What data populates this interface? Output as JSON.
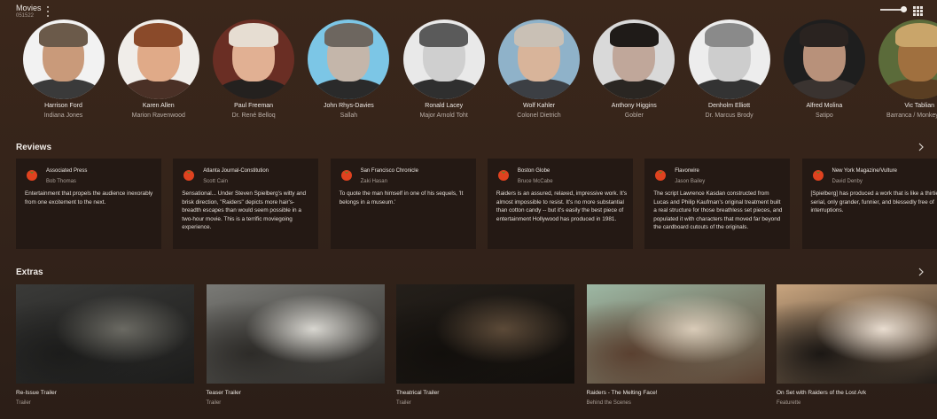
{
  "app": {
    "title": "Movies",
    "subtitle": "051522"
  },
  "view": {
    "zoom_level": 0.85
  },
  "cast": [
    {
      "name": "Harrison Ford",
      "character": "Indiana Jones",
      "bg": "#f2f2f2",
      "face": "#c99a7a",
      "hair": "#6b5a4a",
      "shirt": "#3a3a3a"
    },
    {
      "name": "Karen Allen",
      "character": "Marion Ravenwood",
      "bg": "#f0ede9",
      "face": "#e0aa88",
      "hair": "#8a4a2a",
      "shirt": "#4a3026"
    },
    {
      "name": "Paul Freeman",
      "character": "Dr. René Belloq",
      "bg": "#6a2e24",
      "face": "#e1b093",
      "hair": "#e6ddd2",
      "shirt": "#24211f"
    },
    {
      "name": "John Rhys-Davies",
      "character": "Sallah",
      "bg": "#7cc6e6",
      "face": "#c4b6aa",
      "hair": "#6d665f",
      "shirt": "#2a2a2a"
    },
    {
      "name": "Ronald Lacey",
      "character": "Major Arnold Toht",
      "bg": "#e9e9e9",
      "face": "#cfcfcf",
      "hair": "#5a5a5a",
      "shirt": "#2f2f2f"
    },
    {
      "name": "Wolf Kahler",
      "character": "Colonel Dietrich",
      "bg": "#8fb2c9",
      "face": "#d8b49a",
      "hair": "#c9c0b5",
      "shirt": "#3c3f44"
    },
    {
      "name": "Anthony Higgins",
      "character": "Gobler",
      "bg": "#d9d9d9",
      "face": "#c0a79a",
      "hair": "#1f1b18",
      "shirt": "#2a2622"
    },
    {
      "name": "Denholm Elliott",
      "character": "Dr. Marcus Brody",
      "bg": "#ededed",
      "face": "#cdcdcd",
      "hair": "#8a8a8a",
      "shirt": "#333333"
    },
    {
      "name": "Alfred Molina",
      "character": "Satipo",
      "bg": "#1e1e1e",
      "face": "#b8917a",
      "hair": "#2a2320",
      "shirt": "#3a3330"
    },
    {
      "name": "Vic Tablian",
      "character": "Barranca / Monkey Man",
      "bg": "#5b6b3a",
      "face": "#a0703f",
      "hair": "#c9a56a",
      "shirt": "#5a3e22"
    }
  ],
  "reviews": {
    "title": "Reviews",
    "items": [
      {
        "publisher": "Associated Press",
        "critic": "Bob Thomas",
        "quote": "Entertainment that propels the audience inexorably from one excitement to the next."
      },
      {
        "publisher": "Atlanta Journal-Constitution",
        "critic": "Scott Cain",
        "quote": "Sensational... Under Steven Spielberg's witty and brisk direction, \"Raiders\" depicts more hair's-breadth escapes than would seem possible in a two-hour movie. This is a terrific moviegoing experience."
      },
      {
        "publisher": "San Francisco Chronicle",
        "critic": "Zaki Hasan",
        "quote": "To quote the man himself in one of his sequels, 'It belongs in a museum.'"
      },
      {
        "publisher": "Boston Globe",
        "critic": "Bruce McCabe",
        "quote": "Raiders is an assured, relaxed, impressive work. It's almost impossible to resist. It's no more substantial than cotton candy -- but it's easily the best piece of entertainment Hollywood has produced in 1981."
      },
      {
        "publisher": "Flavorwire",
        "critic": "Jason Bailey",
        "quote": "The script Lawrence Kasdan constructed from Lucas and Philip Kaufman's original treatment built a real structure for those breathless set pieces, and populated it with characters that moved far beyond the cardboard cutouts of the originals."
      },
      {
        "publisher": "New York Magazine/Vulture",
        "critic": "David Denby",
        "quote": "[Spielberg] has produced a work that is like a thirties serial, only grander, funnier, and blessedly free of interruptions."
      }
    ]
  },
  "extras": {
    "title": "Extras",
    "items": [
      {
        "title": "Re-Issue Trailer",
        "type": "Trailer",
        "palette": [
          "#3a3a38",
          "#6b6a63",
          "#1c1c1b"
        ]
      },
      {
        "title": "Teaser Trailer",
        "type": "Trailer",
        "palette": [
          "#7a7a76",
          "#d8d6d0",
          "#2d2b28"
        ]
      },
      {
        "title": "Theatrical Trailer",
        "type": "Trailer",
        "palette": [
          "#241f1a",
          "#5c4a38",
          "#120f0c"
        ]
      },
      {
        "title": "Raiders - The Melting Face!",
        "type": "Behind the Scenes",
        "palette": [
          "#9db8a4",
          "#d9cbb8",
          "#5a4030"
        ]
      },
      {
        "title": "On Set with Raiders of the Lost Ark",
        "type": "Featurette",
        "palette": [
          "#c9a57f",
          "#e9ddd0",
          "#1b1714"
        ]
      }
    ]
  },
  "colors": {
    "background": "#3b271b",
    "card": "#241914",
    "tomato": "#e0421f",
    "stem": "#3f8f2f"
  },
  "icons": {
    "menu": "kebab-menu-icon",
    "grid": "grid-view-icon",
    "next": "chevron-right-icon",
    "review": "tomato-icon"
  }
}
